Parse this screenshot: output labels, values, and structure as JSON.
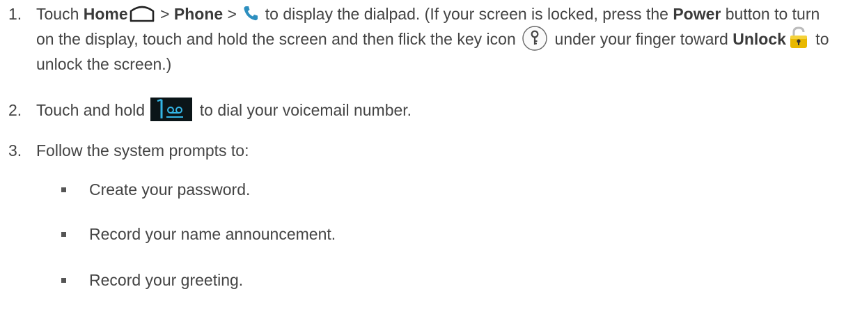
{
  "steps": [
    {
      "number": "1.",
      "t1": "Touch ",
      "home": "Home",
      "t2": " > ",
      "phone": "Phone",
      "t3": " > ",
      "t4": " to display the dialpad. (If your screen is locked, press the ",
      "power": "Power",
      "t5": " button to turn on the display, touch and hold the screen and then flick the key icon ",
      "t6": " under your finger toward ",
      "unlock": "Unlock",
      "t7": " to unlock the screen.)"
    },
    {
      "number": "2.",
      "t1": "Touch and hold ",
      "t2": " to dial your voicemail number."
    },
    {
      "number": "3.",
      "t1": "Follow the system prompts to:"
    }
  ],
  "subitems": [
    "Create your password.",
    "Record your name announcement.",
    "Record your greeting."
  ],
  "icons": {
    "home": "home-icon",
    "phone": "phone-icon",
    "key": "key-icon",
    "lock": "unlock-icon",
    "voicemail": "voicemail-key-icon"
  },
  "colors": {
    "text": "#444444",
    "voicemail_bg": "#0b1518",
    "voicemail_accent": "#34b5e5",
    "lock_gold": "#e8b800"
  }
}
